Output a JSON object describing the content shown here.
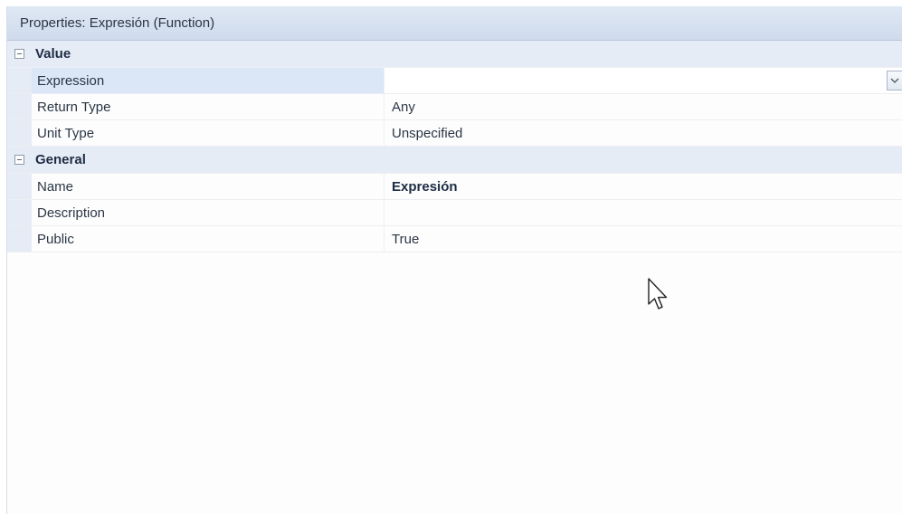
{
  "panel": {
    "title": "Properties: Expresión (Function)"
  },
  "sections": [
    {
      "label": "Value",
      "rows": [
        {
          "key": "Expression",
          "value": ""
        },
        {
          "key": "Return Type",
          "value": "Any"
        },
        {
          "key": "Unit Type",
          "value": "Unspecified"
        }
      ]
    },
    {
      "label": "General",
      "rows": [
        {
          "key": "Name",
          "value": "Expresión"
        },
        {
          "key": "Description",
          "value": ""
        },
        {
          "key": "Public",
          "value": "True"
        }
      ]
    }
  ],
  "icons": {
    "collapse": "collapse-icon",
    "dropdown": "chevron-down-icon",
    "cursor": "mouse-pointer-icon"
  },
  "colors": {
    "title_bar": "#d6e0ef",
    "section_band": "#e6ecf5",
    "selected_row": "#dbe6f6"
  }
}
